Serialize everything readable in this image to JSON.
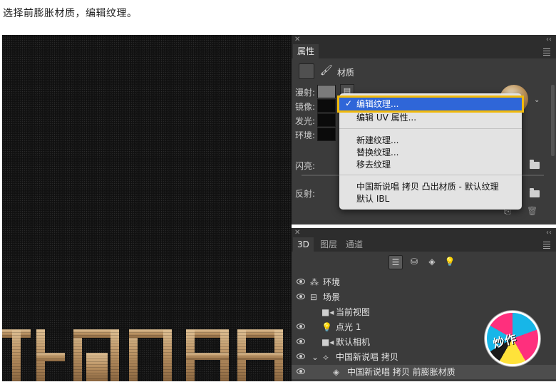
{
  "caption": "选择前膨胀材质，编辑纹理。",
  "canvas": {
    "bottom_text": "说唱"
  },
  "properties": {
    "tab_title": "属性",
    "section_title": "材质",
    "rows": {
      "diffuse": "漫射:",
      "specular": "镜像:",
      "glow": "发光:",
      "ambient": "环境:",
      "shine": "闪亮:",
      "reflection": "反射:"
    }
  },
  "dropdown": {
    "selected": "编辑纹理...",
    "items": [
      "编辑 UV 属性...",
      "新建纹理...",
      "替换纹理...",
      "移去纹理",
      "中国新说唱 拷贝 凸出材质 - 默认纹理",
      "默认 IBL"
    ]
  },
  "layers_panel": {
    "tabs": [
      "3D",
      "图层",
      "通道"
    ],
    "rows": [
      "环境",
      "场景",
      "当前视图",
      "点光 1",
      "默认相机",
      "中国新说唱 拷贝",
      "中国新说唱 拷贝 前膨胀材质"
    ]
  },
  "sticker": {
    "text": "炒作"
  },
  "colors": {
    "highlight": "#2f66d8",
    "outline": "#f0b90b",
    "panel_bg": "#3b3b3b",
    "gold": "#b89061"
  }
}
